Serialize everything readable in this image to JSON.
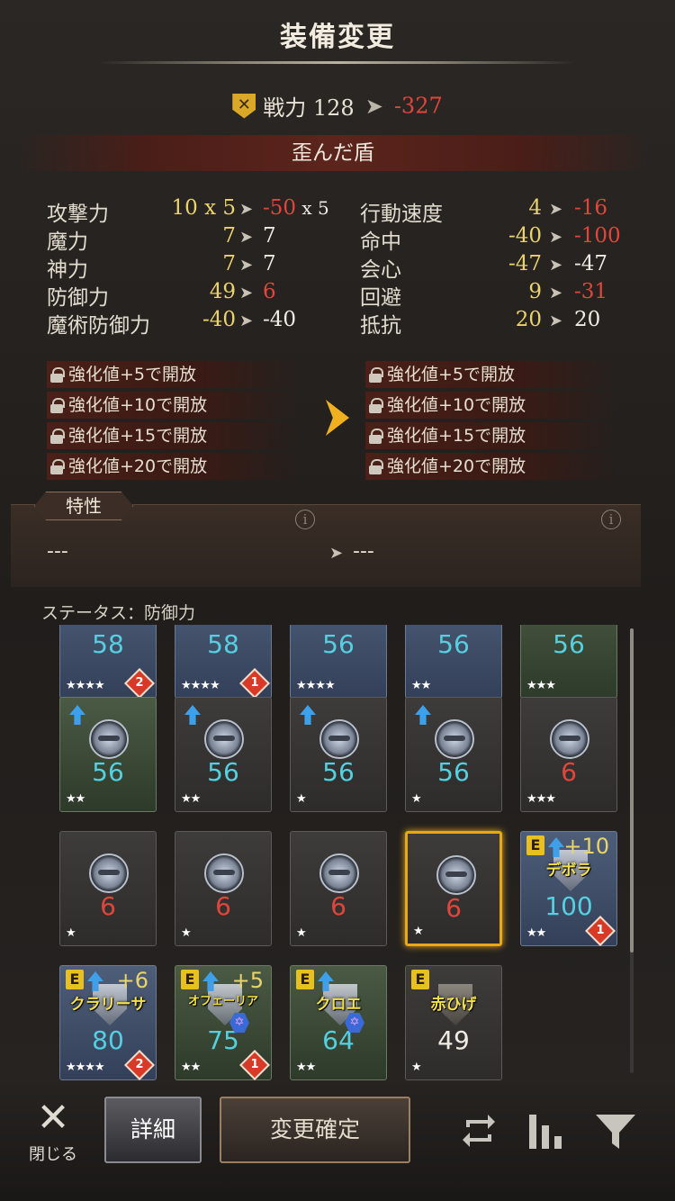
{
  "header": {
    "title": "装備変更"
  },
  "power": {
    "icon": "crossed-swords-shield-icon",
    "from": "戦力 128",
    "to": "-327"
  },
  "item_name": "歪んだ盾",
  "stats_left": [
    {
      "label": "攻撃力",
      "from": "10 x 5",
      "to_val": "-50",
      "to_suffix": " x 5",
      "from_color": "yel",
      "to_color": "red"
    },
    {
      "label": "魔力",
      "from": "7",
      "to_val": "7",
      "to_suffix": "",
      "from_color": "yel",
      "to_color": "wht"
    },
    {
      "label": "神力",
      "from": "7",
      "to_val": "7",
      "to_suffix": "",
      "from_color": "yel",
      "to_color": "wht"
    },
    {
      "label": "防御力",
      "from": "49",
      "to_val": "6",
      "to_suffix": "",
      "from_color": "yel",
      "to_color": "red"
    },
    {
      "label": "魔術防御力",
      "from": "-40",
      "to_val": "-40",
      "to_suffix": "",
      "from_color": "yel",
      "to_color": "wht"
    }
  ],
  "stats_right": [
    {
      "label": "行動速度",
      "from": "4",
      "to_val": "-16",
      "from_color": "yel",
      "to_color": "red"
    },
    {
      "label": "命中",
      "from": "-40",
      "to_val": "-100",
      "from_color": "yel",
      "to_color": "red"
    },
    {
      "label": "会心",
      "from": "-47",
      "to_val": "-47",
      "from_color": "yel",
      "to_color": "wht"
    },
    {
      "label": "回避",
      "from": "9",
      "to_val": "-31",
      "from_color": "yel",
      "to_color": "red"
    },
    {
      "label": "抵抗",
      "from": "20",
      "to_val": "20",
      "from_color": "yel",
      "to_color": "wht"
    }
  ],
  "locks": [
    "強化値+5で開放",
    "強化値+10で開放",
    "強化値+15で開放",
    "強化値+20で開放"
  ],
  "traits": {
    "tag": "特性",
    "left_value": "---",
    "right_value": "---",
    "info_symbol": "i"
  },
  "status_label": "ステータス：防御力",
  "cards": [
    {
      "row": 0,
      "col": 0,
      "bg": "blue",
      "value": "58",
      "value_color": "cyan",
      "stars": "★★★★",
      "badge": "2"
    },
    {
      "row": 0,
      "col": 1,
      "bg": "blue",
      "value": "58",
      "value_color": "cyan",
      "stars": "★★★★",
      "badge": "1"
    },
    {
      "row": 0,
      "col": 2,
      "bg": "blue",
      "value": "56",
      "value_color": "cyan",
      "stars": "★★★★"
    },
    {
      "row": 0,
      "col": 3,
      "bg": "blue",
      "value": "56",
      "value_color": "cyan",
      "stars": "★★"
    },
    {
      "row": 0,
      "col": 4,
      "bg": "green",
      "value": "56",
      "value_color": "cyan",
      "stars": "★★★"
    },
    {
      "row": 1,
      "col": 0,
      "bg": "green",
      "value": "56",
      "value_color": "cyan",
      "stars": "★★",
      "up": true,
      "shield": "round"
    },
    {
      "row": 1,
      "col": 1,
      "bg": "gray",
      "value": "56",
      "value_color": "cyan",
      "stars": "★★",
      "up": true,
      "shield": "round"
    },
    {
      "row": 1,
      "col": 2,
      "bg": "gray",
      "value": "56",
      "value_color": "cyan",
      "stars": "★",
      "up": true,
      "shield": "round"
    },
    {
      "row": 1,
      "col": 3,
      "bg": "gray",
      "value": "56",
      "value_color": "cyan",
      "stars": "★",
      "up": true,
      "shield": "round"
    },
    {
      "row": 1,
      "col": 4,
      "bg": "gray",
      "value": "6",
      "value_color": "red",
      "stars": "★★★",
      "shield": "round"
    },
    {
      "row": 2,
      "col": 0,
      "bg": "gray",
      "value": "6",
      "value_color": "red",
      "stars": "★",
      "shield": "round"
    },
    {
      "row": 2,
      "col": 1,
      "bg": "gray",
      "value": "6",
      "value_color": "red",
      "stars": "★",
      "shield": "round"
    },
    {
      "row": 2,
      "col": 2,
      "bg": "gray",
      "value": "6",
      "value_color": "red",
      "stars": "★",
      "shield": "round"
    },
    {
      "row": 2,
      "col": 3,
      "bg": "gray",
      "value": "6",
      "value_color": "red",
      "stars": "★",
      "shield": "round",
      "selected": true
    },
    {
      "row": 2,
      "col": 4,
      "bg": "blue",
      "value": "100",
      "value_color": "cyan",
      "stars": "★★",
      "badge": "1",
      "equip": "E",
      "up": true,
      "plus": "+10",
      "name": "デボラ",
      "shield": "tall"
    },
    {
      "row": 3,
      "col": 0,
      "bg": "blue",
      "value": "80",
      "value_color": "cyan",
      "stars": "★★★★",
      "badge": "2",
      "equip": "E",
      "up": true,
      "plus": "+6",
      "name": "クラリーサ",
      "shield": "tall"
    },
    {
      "row": 3,
      "col": 1,
      "bg": "green",
      "value": "75",
      "value_color": "cyan",
      "stars": "★★",
      "badge": "1",
      "equip": "E",
      "up": true,
      "plus": "+5",
      "name": "オフェーリア",
      "name_small": true,
      "shield": "tall",
      "hex": true
    },
    {
      "row": 3,
      "col": 2,
      "bg": "green",
      "value": "64",
      "value_color": "cyan",
      "stars": "★★",
      "equip": "E",
      "up": true,
      "name": "クロエ",
      "shield": "tall",
      "hex": true
    },
    {
      "row": 3,
      "col": 3,
      "bg": "gray",
      "value": "49",
      "value_color": "wht",
      "stars": "★",
      "equip": "E",
      "name": "赤ひげ",
      "shield": "tall-dark"
    }
  ],
  "footer": {
    "close_label": "閉じる",
    "detail_label": "詳細",
    "confirm_label": "変更確定",
    "icons": [
      "sync-icon",
      "bar-chart-icon",
      "filter-icon"
    ]
  }
}
